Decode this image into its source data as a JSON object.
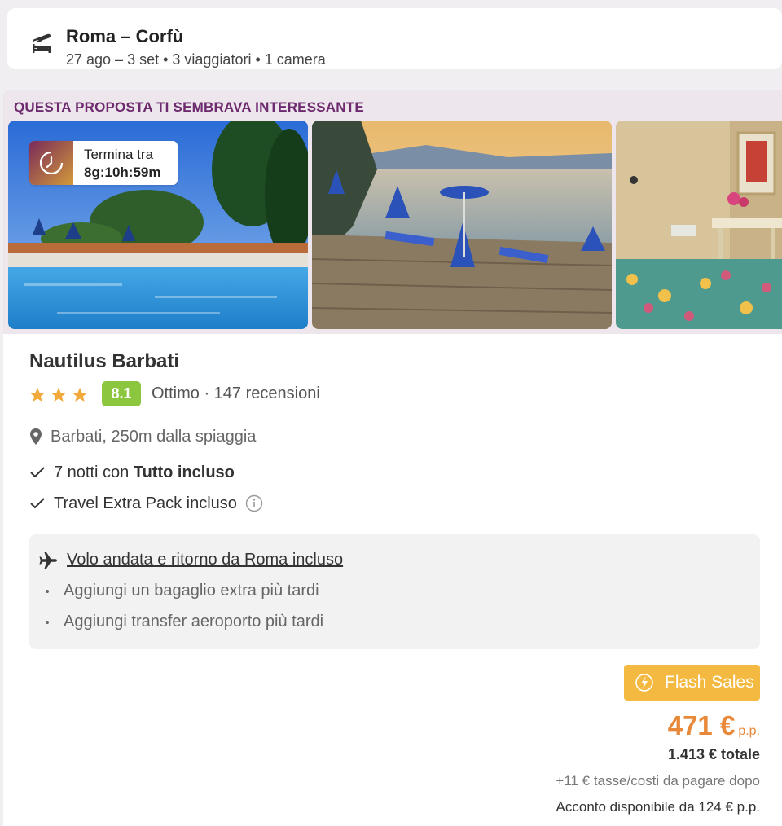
{
  "search": {
    "title": "Roma – Corfù",
    "subtitle": "27 ago – 3 set • 3 viaggiatori • 1 camera",
    "icon": "flight-hotel-icon"
  },
  "card": {
    "tag": "QUESTA PROPOSTA TI SEMBRAVA INTERESSANTE",
    "timer": {
      "label": "Termina tra",
      "value": "8g:10h:59m",
      "icon": "timer-icon"
    },
    "photos": [
      "pool-photo",
      "sea-deck-photo",
      "room-photo"
    ],
    "hotel": {
      "name": "Nautilus Barbati",
      "stars": 3,
      "score": "8.1",
      "rating_text": "Ottimo · 147 recensioni",
      "location": "Barbati, 250m dalla spiaggia"
    },
    "features": [
      {
        "prefix": "7 notti con ",
        "bold": "Tutto incluso"
      },
      {
        "prefix": "Travel Extra Pack incluso",
        "bold": ""
      }
    ],
    "flight": {
      "headline": "Volo andata e ritorno da Roma incluso",
      "extras": [
        "Aggiungi un bagaglio extra più tardi",
        "Aggiungi transfer aeroporto più tardi"
      ]
    },
    "pricing": {
      "badge": "Flash Sales",
      "price": "471 €",
      "per_person": "p.p.",
      "total": "1.413 € totale",
      "taxes": "+11 € tasse/costi da pagare dopo",
      "deposit": "Acconto disponibile da 124 € p.p."
    }
  },
  "colors": {
    "accent": "#6d2a6e",
    "price": "#e8893a",
    "flash": "#f4b940",
    "score": "#8cc63f",
    "star": "#f2a93b"
  }
}
